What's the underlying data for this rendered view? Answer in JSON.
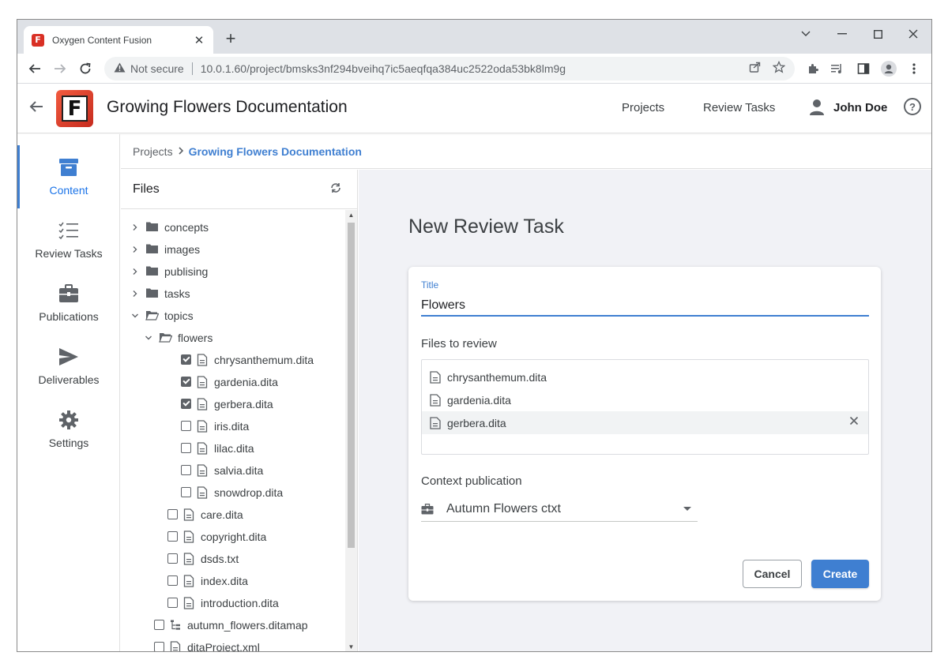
{
  "browser": {
    "tab_title": "Oxygen Content Fusion",
    "favicon_letter": "F",
    "omnibox": {
      "security_label": "Not secure",
      "url": "10.0.1.60/project/bmsks3nf294bveihq7ic5aeqfqa384uc2522oda53bk8lm9g"
    }
  },
  "header": {
    "logo_letter": "F",
    "title": "Growing Flowers Documentation",
    "links": {
      "projects": "Projects",
      "review_tasks": "Review Tasks"
    },
    "user_name": "John Doe",
    "help_glyph": "?"
  },
  "leftnav": {
    "items": [
      {
        "label": "Content",
        "icon": "archive-box-icon",
        "active": true
      },
      {
        "label": "Review Tasks",
        "icon": "checklist-icon",
        "active": false
      },
      {
        "label": "Publications",
        "icon": "briefcase-icon",
        "active": false
      },
      {
        "label": "Deliverables",
        "icon": "send-icon",
        "active": false
      },
      {
        "label": "Settings",
        "icon": "gear-icon",
        "active": false
      }
    ]
  },
  "breadcrumb": {
    "root": "Projects",
    "current": "Growing Flowers Documentation"
  },
  "files": {
    "title": "Files",
    "tree": [
      {
        "label": "concepts",
        "type": "folder",
        "depth": 0,
        "expanded": false
      },
      {
        "label": "images",
        "type": "folder",
        "depth": 0,
        "expanded": false
      },
      {
        "label": "publising",
        "type": "folder",
        "depth": 0,
        "expanded": false
      },
      {
        "label": "tasks",
        "type": "folder",
        "depth": 0,
        "expanded": false
      },
      {
        "label": "topics",
        "type": "folder",
        "depth": 0,
        "expanded": true
      },
      {
        "label": "flowers",
        "type": "folder",
        "depth": 1,
        "expanded": true
      },
      {
        "label": "chrysanthemum.dita",
        "type": "file",
        "depth": 2,
        "checked": true
      },
      {
        "label": "gardenia.dita",
        "type": "file",
        "depth": 2,
        "checked": true
      },
      {
        "label": "gerbera.dita",
        "type": "file",
        "depth": 2,
        "checked": true
      },
      {
        "label": "iris.dita",
        "type": "file",
        "depth": 2,
        "checked": false
      },
      {
        "label": "lilac.dita",
        "type": "file",
        "depth": 2,
        "checked": false
      },
      {
        "label": "salvia.dita",
        "type": "file",
        "depth": 2,
        "checked": false
      },
      {
        "label": "snowdrop.dita",
        "type": "file",
        "depth": 2,
        "checked": false
      },
      {
        "label": "care.dita",
        "type": "file",
        "depth": 1,
        "checked": false
      },
      {
        "label": "copyright.dita",
        "type": "file",
        "depth": 1,
        "checked": false
      },
      {
        "label": "dsds.txt",
        "type": "file",
        "depth": 1,
        "checked": false
      },
      {
        "label": "index.dita",
        "type": "file",
        "depth": 1,
        "checked": false
      },
      {
        "label": "introduction.dita",
        "type": "file",
        "depth": 1,
        "checked": false
      },
      {
        "label": "autumn_flowers.ditamap",
        "type": "map",
        "depth": 0,
        "checked": false
      },
      {
        "label": "ditaProject.xml",
        "type": "file",
        "depth": 0,
        "checked": false
      }
    ]
  },
  "review_task": {
    "heading": "New Review Task",
    "title_label": "Title",
    "title_value": "Flowers",
    "files_label": "Files to review",
    "files": [
      {
        "name": "chrysanthemum.dita",
        "hovered": false
      },
      {
        "name": "gardenia.dita",
        "hovered": false
      },
      {
        "name": "gerbera.dita",
        "hovered": true
      }
    ],
    "context_label": "Context publication",
    "context_value": "Autumn Flowers ctxt",
    "cancel_label": "Cancel",
    "create_label": "Create"
  },
  "colors": {
    "accent": "#3f7fd1",
    "logo_red": "#d93025",
    "main_bg": "#f1f2f6"
  }
}
